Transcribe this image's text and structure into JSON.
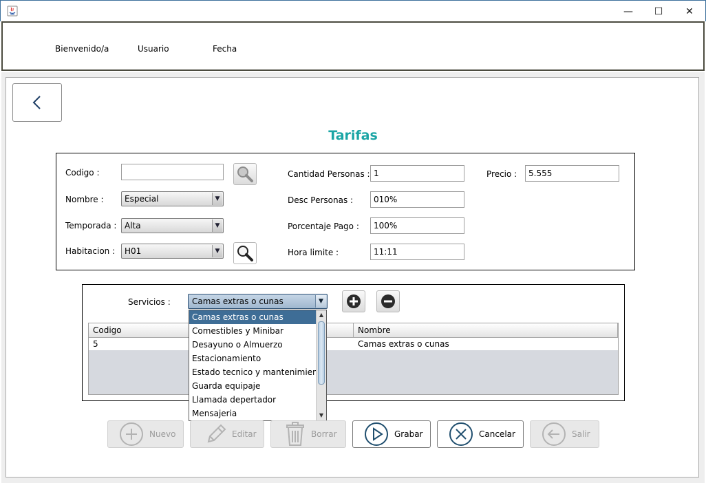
{
  "window": {
    "minimize": "—",
    "maximize": "☐",
    "close": "✕"
  },
  "header": {
    "welcome": "Bienvenido/a",
    "user": "Usuario",
    "date": "Fecha"
  },
  "page": {
    "title": "Tarifas"
  },
  "form": {
    "codigo_label": "Codigo :",
    "codigo_value": "",
    "nombre_label": "Nombre :",
    "nombre_value": "Especial",
    "temporada_label": "Temporada :",
    "temporada_value": "Alta",
    "habitacion_label": "Habitacion :",
    "habitacion_value": "H01",
    "cantidad_label": "Cantidad Personas :",
    "cantidad_value": "1",
    "desc_label": "Desc Personas :",
    "desc_value": "010%",
    "porcentaje_label": "Porcentaje Pago :",
    "porcentaje_value": "100%",
    "hora_label": "Hora limite :",
    "hora_value": "11:11",
    "precio_label": "Precio :",
    "precio_value": "5.555"
  },
  "servicios": {
    "label": "Servicios :",
    "selected": "Camas extras o cunas",
    "options": [
      "Camas extras o cunas",
      "Comestibles y Minibar",
      "Desayuno o Almuerzo",
      "Estacionamiento",
      "Estado tecnico y mantenimiento",
      "Guarda equipaje",
      "Llamada depertador",
      "Mensajeria"
    ]
  },
  "table": {
    "columns": [
      "Codigo",
      "Nombre"
    ],
    "rows": [
      {
        "codigo": "5",
        "nombre": "Camas extras o cunas"
      }
    ]
  },
  "actions": {
    "nuevo": "Nuevo",
    "editar": "Editar",
    "borrar": "Borrar",
    "grabar": "Grabar",
    "cancelar": "Cancelar",
    "salir": "Salir"
  },
  "colors": {
    "title": "#1aa5a5",
    "selection": "#3e6d96",
    "icon_blue": "#1f4e6e"
  }
}
